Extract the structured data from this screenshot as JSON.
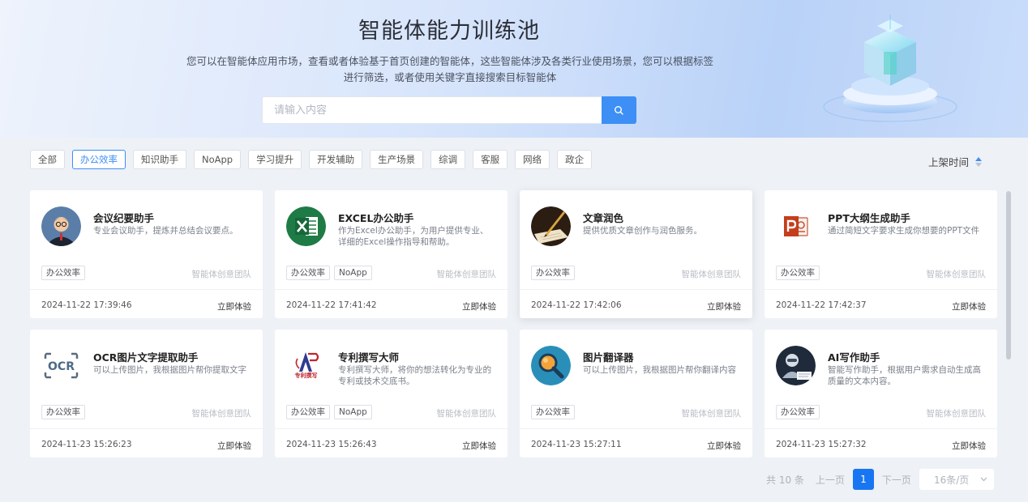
{
  "hero": {
    "title": "智能体能力训练池",
    "description": "您可以在智能体应用市场，查看或者体验基于首页创建的智能体，这些智能体涉及各类行业使用场景，您可以根据标签进行筛选，或者使用关键字直接搜索目标智能体",
    "search_placeholder": "请输入内容"
  },
  "filters": {
    "tags": [
      "全部",
      "办公效率",
      "知识助手",
      "NoApp",
      "学习提升",
      "开发辅助",
      "生产场景",
      "综调",
      "客服",
      "网络",
      "政企"
    ],
    "active_tag": "办公效率",
    "sort_label": "上架时间"
  },
  "cards": [
    {
      "name": "会议纪要助手",
      "desc": "专业会议助手，提炼并总结会议要点。",
      "tags": [
        "办公效率"
      ],
      "team": "智能体创意团队",
      "time": "2024-11-22 17:39:46",
      "action": "立即体验",
      "icon": "meeting-avatar-icon"
    },
    {
      "name": "EXCEL办公助手",
      "desc": "作为Excel办公助手，为用户提供专业、详细的Excel操作指导和帮助。",
      "tags": [
        "办公效率",
        "NoApp"
      ],
      "team": "智能体创意团队",
      "time": "2024-11-22 17:41:42",
      "action": "立即体验",
      "icon": "excel-icon"
    },
    {
      "name": "文章润色",
      "desc": "提供优质文章创作与润色服务。",
      "tags": [
        "办公效率"
      ],
      "team": "智能体创意团队",
      "time": "2024-11-22 17:42:06",
      "action": "立即体验",
      "icon": "pen-writing-icon"
    },
    {
      "name": "PPT大纲生成助手",
      "desc": "通过简短文字要求生成你想要的PPT文件",
      "tags": [
        "办公效率"
      ],
      "team": "智能体创意团队",
      "time": "2024-11-22 17:42:37",
      "action": "立即体验",
      "icon": "powerpoint-icon"
    },
    {
      "name": "OCR图片文字提取助手",
      "desc": "可以上传图片，我根据图片帮你提取文字",
      "tags": [
        "办公效率"
      ],
      "team": "智能体创意团队",
      "time": "2024-11-23 15:26:23",
      "action": "立即体验",
      "icon": "ocr-icon"
    },
    {
      "name": "专利撰写大师",
      "desc": "专利撰写大师，将你的想法转化为专业的专利或技术交底书。",
      "tags": [
        "办公效率",
        "NoApp"
      ],
      "team": "智能体创意团队",
      "time": "2024-11-23 15:26:43",
      "action": "立即体验",
      "icon": "patent-logo-icon",
      "icon_text": "专利撰写"
    },
    {
      "name": "图片翻译器",
      "desc": "可以上传图片，我根据图片帮你翻译内容",
      "tags": [
        "办公效率"
      ],
      "team": "智能体创意团队",
      "time": "2024-11-23 15:27:11",
      "action": "立即体验",
      "icon": "magnifier-icon"
    },
    {
      "name": "AI写作助手",
      "desc": "智能写作助手，根据用户需求自动生成高质量的文本内容。",
      "tags": [
        "办公效率"
      ],
      "team": "智能体创意团队",
      "time": "2024-11-23 15:27:32",
      "action": "立即体验",
      "icon": "robot-writer-icon"
    }
  ],
  "pagination": {
    "total": "共 10 条",
    "prev": "上一页",
    "current": "1",
    "next": "下一页",
    "page_size": "16条/页"
  },
  "colors": {
    "accent": "#3d8ff5",
    "active_page": "#1976f2"
  }
}
